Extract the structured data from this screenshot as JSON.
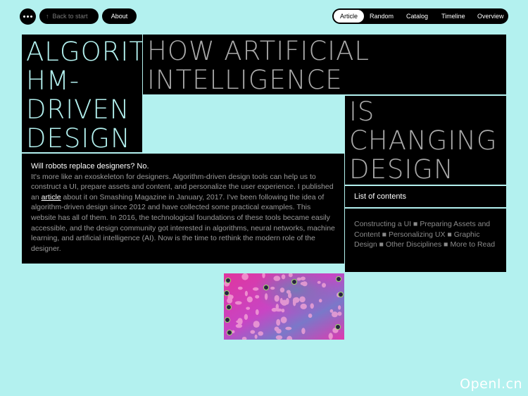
{
  "topbar": {
    "back_label": "Back to start",
    "about_label": "About"
  },
  "nav": {
    "items": [
      "Article",
      "Random",
      "Catalog",
      "Timeline",
      "Overview"
    ],
    "active": "Article"
  },
  "hero": {
    "title_left": [
      "ALGORIT",
      "HM-",
      "DRIVEN",
      "DESIGN"
    ],
    "title_right_top": [
      "HOW ARTIFICIAL",
      "INTELLIGENCE"
    ],
    "title_right_bottom": [
      "IS",
      "CHANGING",
      "DESIGN"
    ]
  },
  "toc": {
    "heading": "List of contents",
    "items": [
      "Constructing a UI",
      "Preparing Assets and Content",
      "Personalizing UX",
      "Graphic Design",
      "Other Disciplines",
      "More to Read"
    ]
  },
  "intro": {
    "lead": "Will robots replace designers? No.",
    "body_before_link": "It's more like an exoskeleton for designers. Algorithm-driven design tools can help us to construct a UI, prepare assets and content, and personalize the user experience. I published an ",
    "link_text": "article",
    "body_after_link": " about it on Smashing Magazine in January, 2017. I've been following the idea of algorithm-driven design since 2012 and have collected some practical examples. This website has all of them. In 2016, the technological foundations of these tools became easily accessible, and the design community got interested in algorithms, neural networks, machine learning, and artificial intelligence (AI). Now is the time to rethink the modern role of the designer."
  },
  "watermark": "OpenI.cn",
  "colors": {
    "background": "#b3f1ef",
    "panel": "#000000",
    "accent_text": "#b3f1ef",
    "muted_text": "#a9a9a9"
  },
  "icons": {
    "menu": "dots-icon",
    "back": "arrow-up-icon"
  }
}
